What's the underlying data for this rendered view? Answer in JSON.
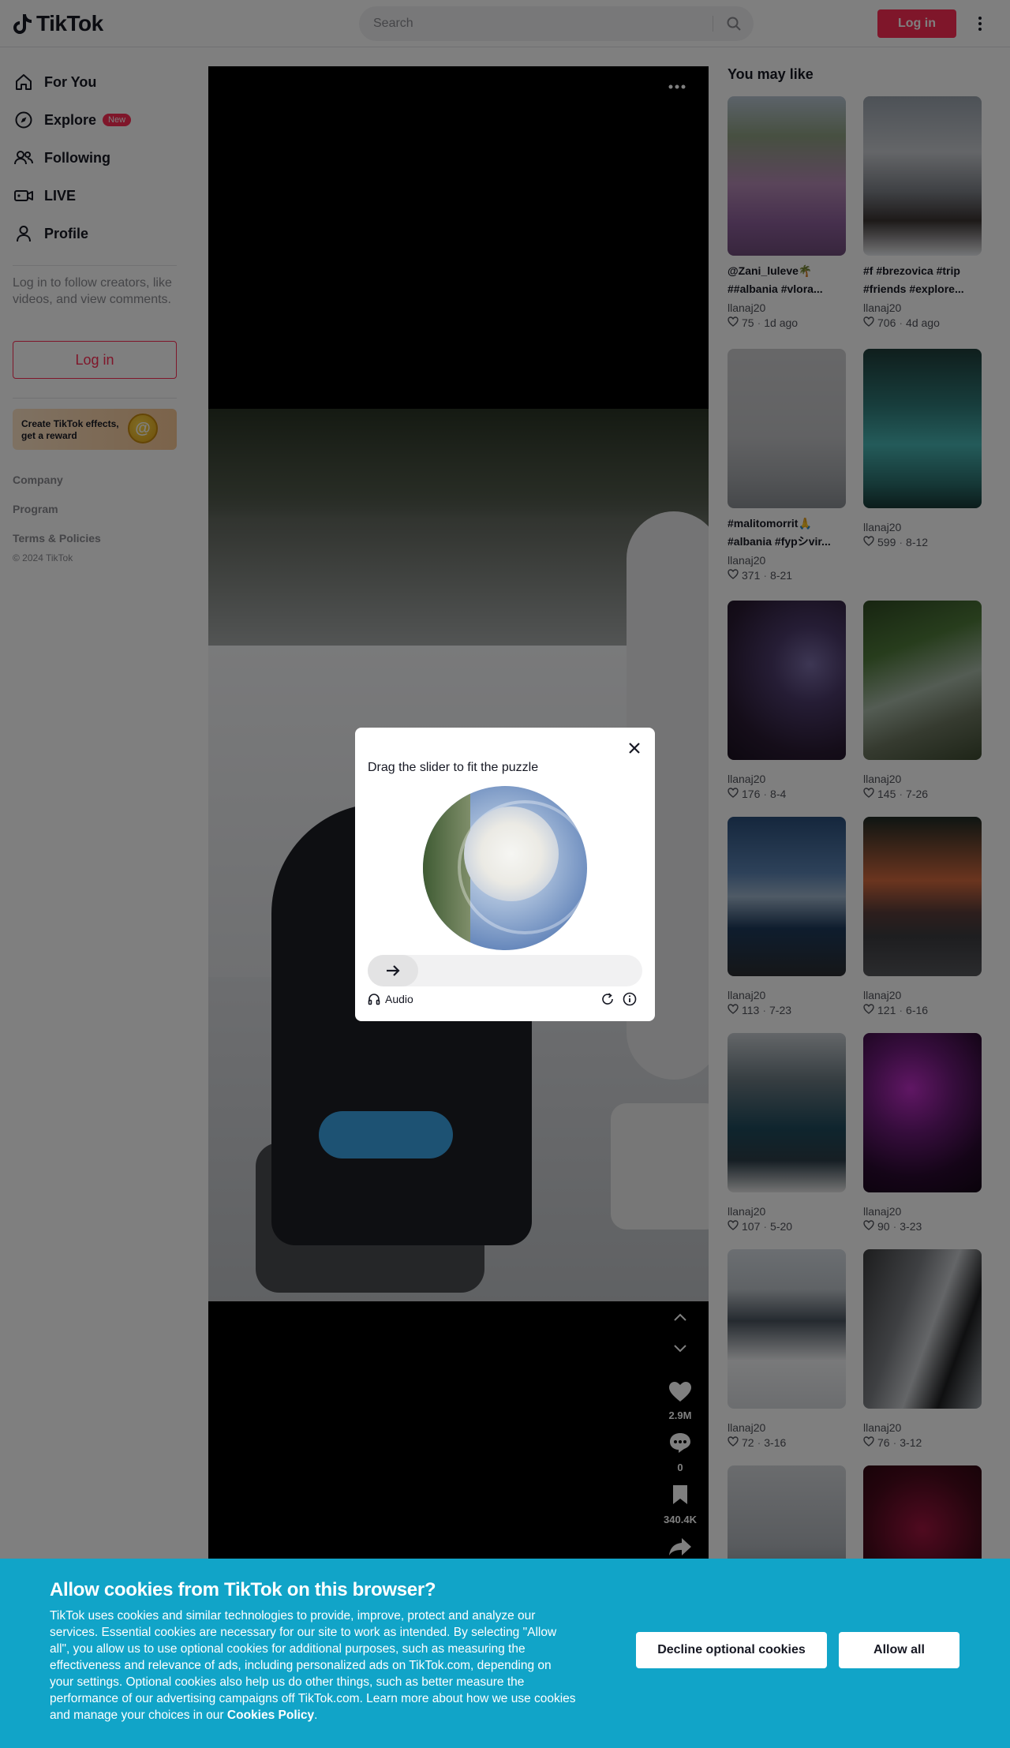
{
  "header": {
    "logo_text": "TikTok",
    "search_placeholder": "Search",
    "login_label": "Log in",
    "more_icon": "vertical-ellipsis-icon"
  },
  "sidebar": {
    "nav": [
      {
        "label": "For You",
        "icon": "home-icon"
      },
      {
        "label": "Explore",
        "icon": "compass-icon",
        "badge": "New"
      },
      {
        "label": "Following",
        "icon": "users-icon"
      },
      {
        "label": "LIVE",
        "icon": "live-camera-icon"
      },
      {
        "label": "Profile",
        "icon": "user-icon"
      }
    ],
    "login_prompt": "Log in to follow creators, like videos, and view comments.",
    "login_label": "Log in",
    "effects_banner": "Create TikTok effects, get a reward",
    "footer": [
      "Company",
      "Program",
      "Terms & Policies"
    ],
    "copyright": "© 2024 TikTok"
  },
  "video": {
    "likes": "2.9M",
    "comments": "0",
    "saves": "340.4K"
  },
  "recommendations": {
    "title": "You may like",
    "items": [
      {
        "caption": [
          "@Zani_luleve🌴",
          "##albania #vlora..."
        ],
        "author": "llanaj20",
        "likes": "75",
        "date": "1d ago"
      },
      {
        "caption": [
          "#f #brezovica #trip",
          "#friends #explore..."
        ],
        "author": "llanaj20",
        "likes": "706",
        "date": "4d ago"
      },
      {
        "caption": [
          "#malitomorrit🙏",
          "#albania #fypシvir..."
        ],
        "author": "llanaj20",
        "likes": "371",
        "date": "8-21"
      },
      {
        "caption": [],
        "author": "llanaj20",
        "likes": "599",
        "date": "8-12"
      },
      {
        "caption": [],
        "author": "llanaj20",
        "likes": "176",
        "date": "8-4"
      },
      {
        "caption": [],
        "author": "llanaj20",
        "likes": "145",
        "date": "7-26"
      },
      {
        "caption": [],
        "author": "llanaj20",
        "likes": "113",
        "date": "7-23"
      },
      {
        "caption": [],
        "author": "llanaj20",
        "likes": "121",
        "date": "6-16"
      },
      {
        "caption": [],
        "author": "llanaj20",
        "likes": "107",
        "date": "5-20"
      },
      {
        "caption": [],
        "author": "llanaj20",
        "likes": "90",
        "date": "3-23"
      },
      {
        "caption": [],
        "author": "llanaj20",
        "likes": "72",
        "date": "3-16"
      },
      {
        "caption": [],
        "author": "llanaj20",
        "likes": "76",
        "date": "3-12"
      }
    ]
  },
  "captcha": {
    "title": "Drag the slider to fit the puzzle",
    "audio_label": "Audio"
  },
  "cookie_banner": {
    "title": "Allow cookies from TikTok on this browser?",
    "body": "TikTok uses cookies and similar technologies to provide, improve, protect and analyze our services. Essential cookies are necessary for our site to work as intended. By selecting \"Allow all\", you allow us to use optional cookies for additional purposes, such as measuring the effectiveness and relevance of ads, including personalized ads on TikTok.com, depending on your settings. Optional cookies also help us do other things, such as better measure the performance of our advertising campaigns off TikTok.com. Learn more about how we use cookies and manage your choices in our",
    "policy_link": "Cookies Policy",
    "decline_label": "Decline optional cookies",
    "allow_label": "Allow all"
  },
  "colors": {
    "brand": "#fe2c55",
    "cookie_bg": "#11a4c8"
  }
}
